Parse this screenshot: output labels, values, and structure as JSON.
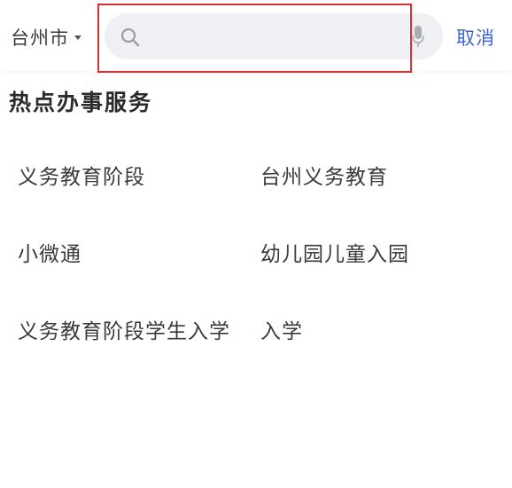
{
  "header": {
    "city": "台州市",
    "search_placeholder": "",
    "search_value": "",
    "cancel_label": "取消"
  },
  "section": {
    "title": "热点办事服务"
  },
  "services": [
    "义务教育阶段",
    "台州义务教育",
    "小微通",
    "幼儿园儿童入园",
    "义务教育阶段学生入学",
    "入学"
  ],
  "colors": {
    "accent": "#3d63d6",
    "search_bg": "#eef0f3",
    "highlight": "#d93038"
  },
  "icons": [
    "caret-down-icon",
    "search-icon",
    "microphone-icon"
  ]
}
